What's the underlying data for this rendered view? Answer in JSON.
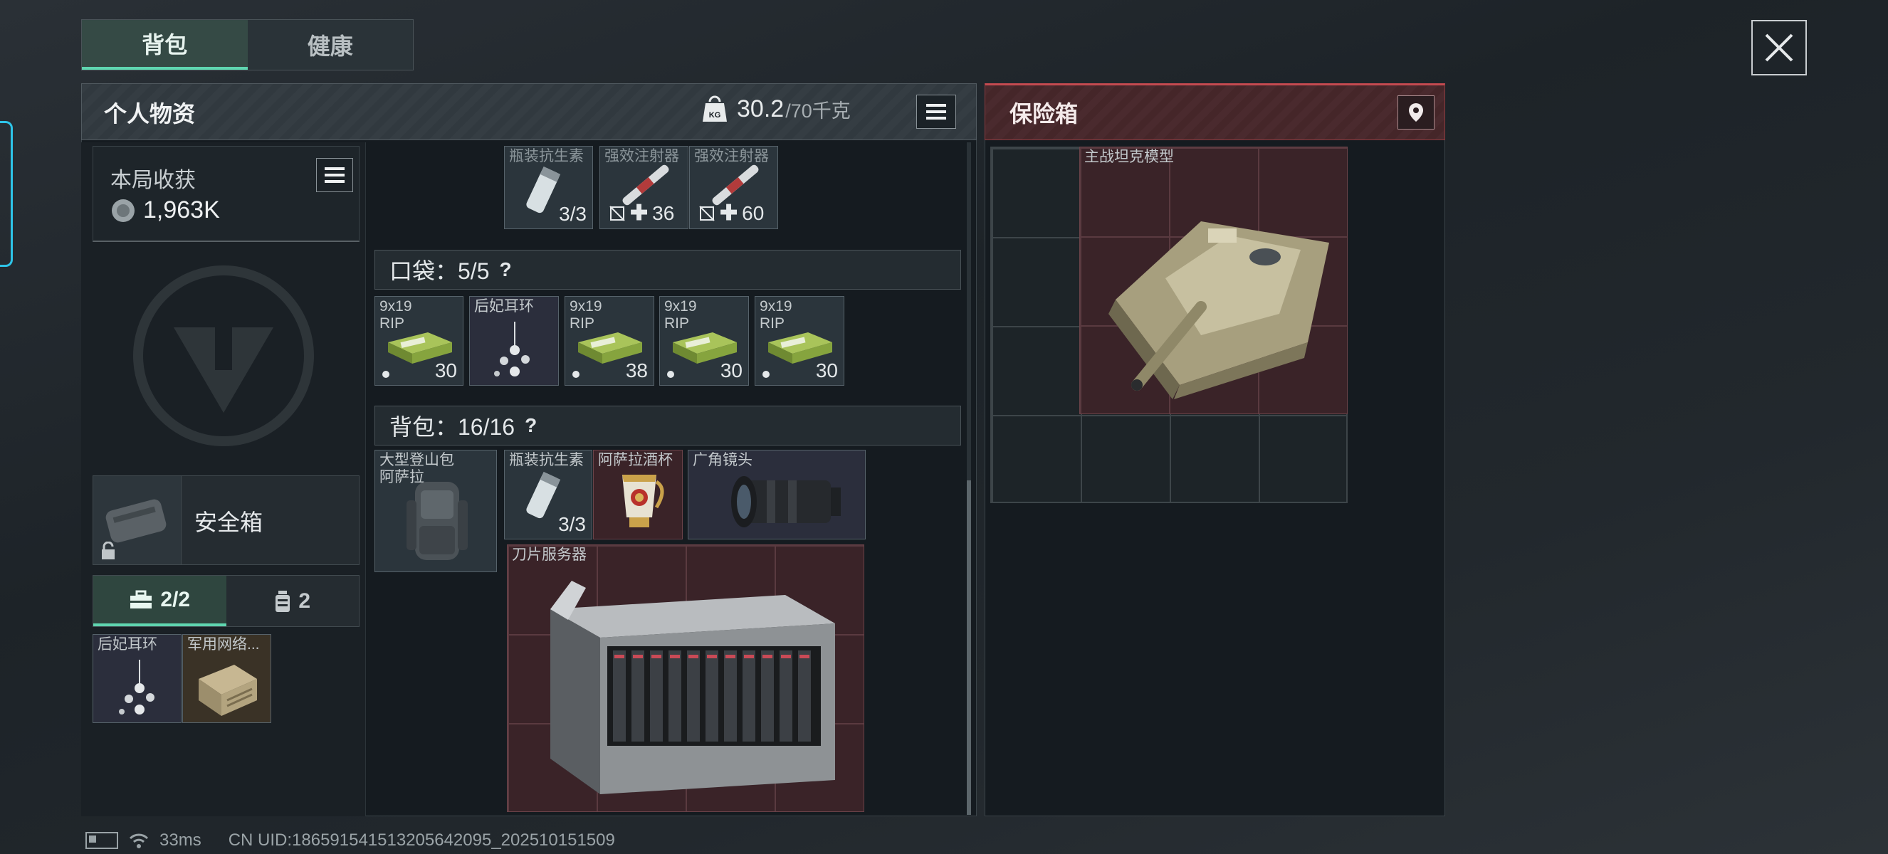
{
  "tabs": {
    "backpack": "背包",
    "health": "健康"
  },
  "left_panel": {
    "title": "个人物资",
    "weight": "30.2",
    "weight_max": "/70千克",
    "weight_icon_text": "KG"
  },
  "harvest": {
    "label": "本局收获",
    "value": "1,963K"
  },
  "safebox": {
    "label": "安全箱"
  },
  "subtabs": {
    "first": "2/2",
    "second": "2"
  },
  "safebox_items": [
    {
      "name": "后妃耳环"
    },
    {
      "name": "军用网络..."
    }
  ],
  "top_items": [
    {
      "name": "瓶装抗生素",
      "count": "3/3"
    },
    {
      "name": "强效注射器",
      "count": "36"
    },
    {
      "name": "强效注射器",
      "count": "60"
    }
  ],
  "pocket": {
    "label": "口袋：5/5",
    "help": "?"
  },
  "pocket_items": [
    {
      "name": "9x19 RIP",
      "count": "30"
    },
    {
      "name": "后妃耳环",
      "count": ""
    },
    {
      "name": "9x19 RIP",
      "count": "38"
    },
    {
      "name": "9x19 RIP",
      "count": "30"
    },
    {
      "name": "9x19 RIP",
      "count": "30"
    }
  ],
  "backpack": {
    "label": "背包：16/16",
    "help": "?"
  },
  "backpack_items": [
    {
      "name": "大型登山包 阿萨拉"
    },
    {
      "name": "瓶装抗生素",
      "count": "3/3"
    },
    {
      "name": "阿萨拉酒杯"
    },
    {
      "name": "广角镜头"
    },
    {
      "name": "刀片服务器"
    }
  ],
  "right_panel": {
    "title": "保险箱"
  },
  "safe_items": [
    {
      "name": "主战坦克模型"
    }
  ],
  "status": {
    "ping": "33ms",
    "uid": "CN UID:186591541513205642095_202510151509"
  }
}
